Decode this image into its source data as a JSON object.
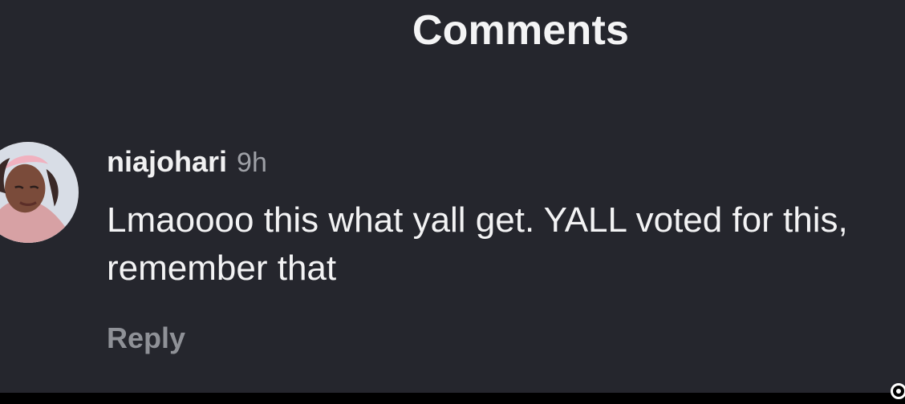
{
  "header": {
    "title": "Comments"
  },
  "comment": {
    "username": "niajohari",
    "time": "9h",
    "text": "Lmaoooo this what yall get. YALL voted for this, remember that",
    "reply_label": "Reply",
    "avatar_icon": "profile-avatar"
  },
  "colors": {
    "background": "#25262d",
    "text_primary": "#f3f3f4",
    "text_secondary": "#9ea0a6",
    "reply": "#8f9197"
  }
}
